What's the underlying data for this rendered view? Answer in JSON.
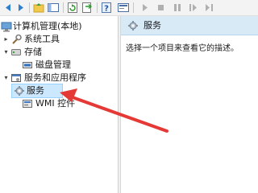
{
  "toolbar": {
    "buttons": [
      "back-icon",
      "forward-icon",
      "up-folder-icon",
      "show-tree-icon",
      "refresh-icon",
      "export-list-icon",
      "help-icon",
      "properties-icon",
      "play-icon",
      "pause-icon",
      "stop-icon",
      "resume-icon",
      "restart-icon"
    ]
  },
  "tree": {
    "root": "计算机管理(本地)",
    "system_tools": "系统工具",
    "storage": "存储",
    "disk_management": "磁盘管理",
    "services_apps": "服务和应用程序",
    "services": "服务",
    "wmi": "WMI 控件"
  },
  "right": {
    "header_title": "服务",
    "description": "选择一个项目来查看它的描述。"
  },
  "colors": {
    "selection_bg": "#cce8ff",
    "header_bg": "#d9eaf7",
    "arrow": "#e53935"
  }
}
